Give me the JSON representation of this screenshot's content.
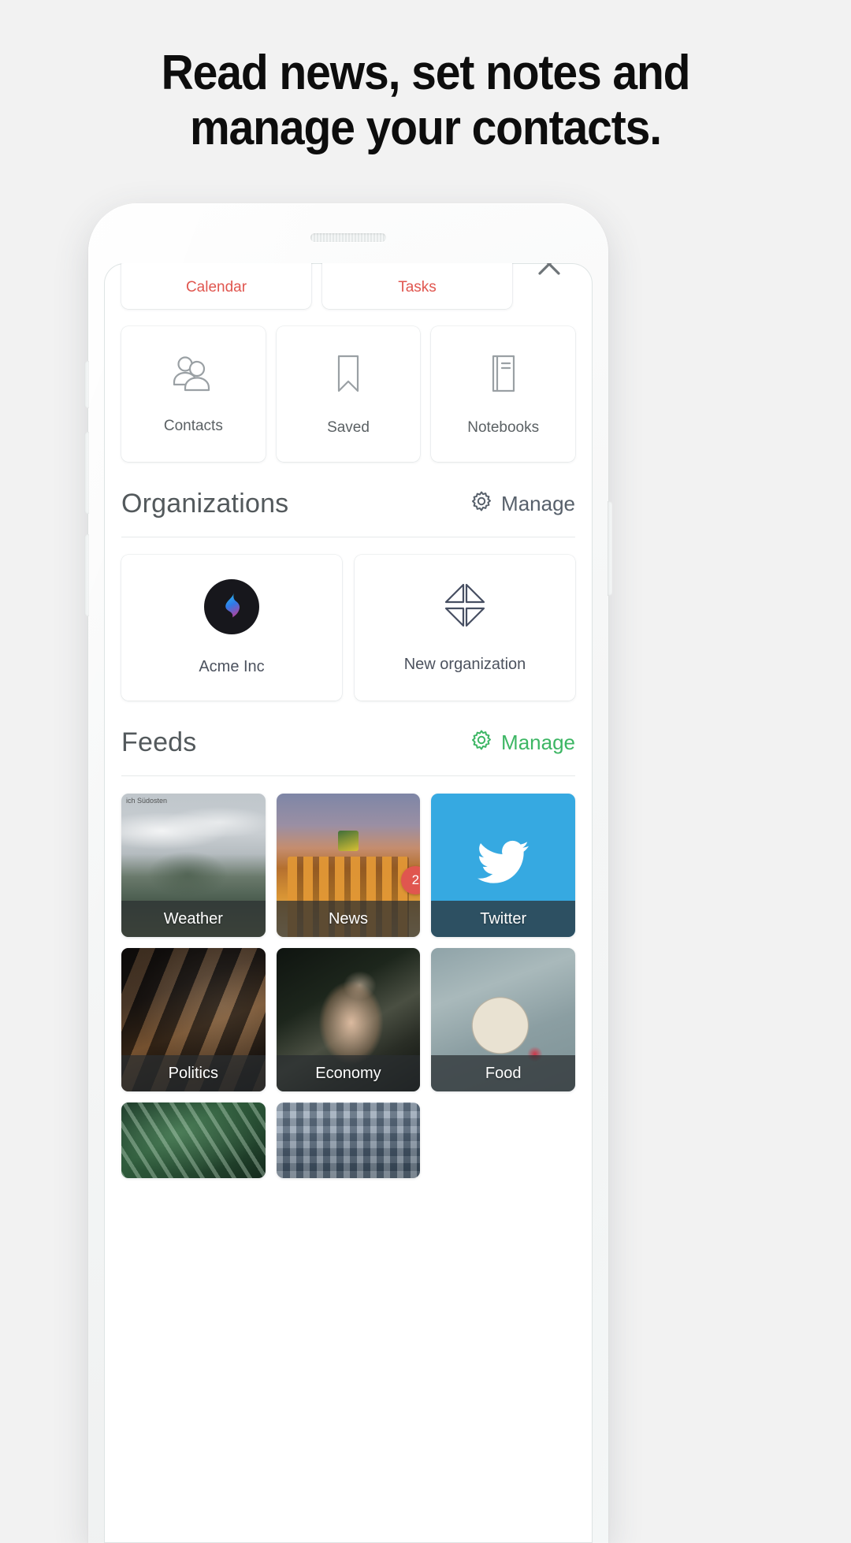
{
  "headline": {
    "line1": "Read news, set notes and",
    "line2": "manage your contacts."
  },
  "colors": {
    "background": "#f2f2f2",
    "accent_red": "#e0564f",
    "accent_green": "#3db664",
    "text_gray": "#5b6164",
    "twitter_blue": "#36a9e1"
  },
  "app": {
    "top_row": {
      "calendar_label": "Calendar",
      "tasks_label": "Tasks",
      "close_label": "close-icon"
    },
    "quick_actions": [
      {
        "label": "Contacts",
        "icon": "people-icon"
      },
      {
        "label": "Saved",
        "icon": "bookmark-icon"
      },
      {
        "label": "Notebooks",
        "icon": "notebook-icon"
      }
    ],
    "organizations": {
      "title": "Organizations",
      "manage_label": "Manage",
      "items": [
        {
          "label": "Acme Inc",
          "icon": "acme-logo"
        },
        {
          "label": "New organization",
          "icon": "four-triangles-icon"
        }
      ]
    },
    "feeds": {
      "title": "Feeds",
      "manage_label": "Manage",
      "items": [
        {
          "label": "Weather",
          "badge": "",
          "style": "bg-weather",
          "caption": "ich Südosten"
        },
        {
          "label": "News",
          "badge": "2",
          "style": "bg-news",
          "caption": ""
        },
        {
          "label": "Twitter",
          "badge": "",
          "style": "twitter-bg",
          "caption": ""
        },
        {
          "label": "Politics",
          "badge": "",
          "style": "bg-politics",
          "caption": ""
        },
        {
          "label": "Economy",
          "badge": "",
          "style": "bg-economy",
          "caption": ""
        },
        {
          "label": "Food",
          "badge": "",
          "style": "bg-food",
          "caption": ""
        }
      ],
      "partial_items": [
        {
          "label": "",
          "style": "bg-plant"
        },
        {
          "label": "",
          "style": "bg-building"
        }
      ]
    }
  }
}
